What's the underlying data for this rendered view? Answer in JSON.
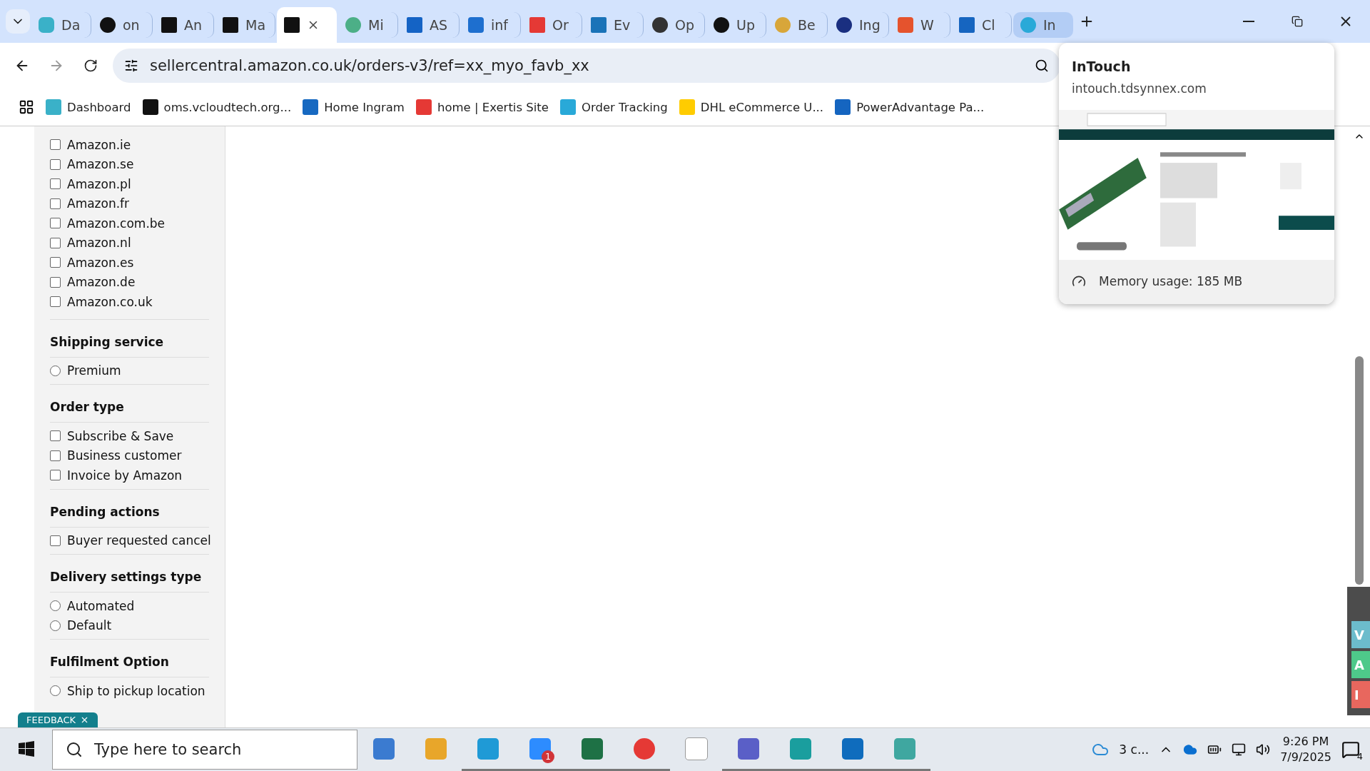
{
  "tabs": [
    {
      "label": "Da",
      "selected": false
    },
    {
      "label": "on",
      "selected": false
    },
    {
      "label": "An",
      "selected": false
    },
    {
      "label": "Ma",
      "selected": false
    },
    {
      "selected": true
    },
    {
      "label": "Mi",
      "selected": false
    },
    {
      "label": "AS",
      "selected": false
    },
    {
      "label": "inf",
      "selected": false
    },
    {
      "label": "Or",
      "selected": false
    },
    {
      "label": "Ev",
      "selected": false
    },
    {
      "label": "Op",
      "selected": false
    },
    {
      "label": "Up",
      "selected": false
    },
    {
      "label": "Be",
      "selected": false
    },
    {
      "label": "Ing",
      "selected": false
    },
    {
      "label": "W",
      "selected": false
    },
    {
      "label": "Cl",
      "selected": false
    },
    {
      "label": "In",
      "selected": false,
      "hovered": true
    }
  ],
  "address_bar": {
    "url": "sellercentral.amazon.co.uk/orders-v3/ref=xx_myo_favb_xx"
  },
  "bookmarks": [
    "Dashboard",
    "oms.vcloudtech.org...",
    "Home Ingram",
    "home | Exertis Site",
    "Order Tracking",
    "DHL eCommerce U...",
    "PowerAdvantage Pa..."
  ],
  "sidebar": {
    "sections": [
      {
        "items": [
          {
            "kind": "checkbox",
            "label": "Amazon.ie",
            "checked": false
          },
          {
            "kind": "checkbox",
            "label": "Amazon.se",
            "checked": false
          },
          {
            "kind": "checkbox",
            "label": "Amazon.pl",
            "checked": false
          },
          {
            "kind": "checkbox",
            "label": "Amazon.fr",
            "checked": false
          },
          {
            "kind": "checkbox",
            "label": "Amazon.com.be",
            "checked": false
          },
          {
            "kind": "checkbox",
            "label": "Amazon.nl",
            "checked": false
          },
          {
            "kind": "checkbox",
            "label": "Amazon.es",
            "checked": false
          },
          {
            "kind": "checkbox",
            "label": "Amazon.de",
            "checked": false
          },
          {
            "kind": "checkbox",
            "label": "Amazon.co.uk",
            "checked": false
          }
        ]
      },
      {
        "title": "Shipping service",
        "items": [
          {
            "kind": "radio",
            "label": "Premium",
            "selected": false
          }
        ]
      },
      {
        "title": "Order type",
        "items": [
          {
            "kind": "checkbox",
            "label": "Subscribe & Save",
            "checked": false
          },
          {
            "kind": "checkbox",
            "label": "Business customer",
            "checked": false
          },
          {
            "kind": "checkbox",
            "label": "Invoice by Amazon",
            "checked": false
          }
        ]
      },
      {
        "title": "Pending actions",
        "items": [
          {
            "kind": "checkbox",
            "label": "Buyer requested cancel",
            "checked": false
          }
        ]
      },
      {
        "title": "Delivery settings type",
        "items": [
          {
            "kind": "radio",
            "label": "Automated",
            "selected": false
          },
          {
            "kind": "radio",
            "label": "Default",
            "selected": false
          }
        ]
      },
      {
        "title": "Fulfilment Option",
        "items": [
          {
            "kind": "radio",
            "label": "Ship to pickup location",
            "selected": false
          }
        ]
      }
    ]
  },
  "feedback": {
    "label": "FEEDBACK"
  },
  "tab_preview": {
    "title": "InTouch",
    "url": "intouch.tdsynnex.com",
    "memory": "Memory usage: 185 MB"
  },
  "side_widget": [
    {
      "label": "V",
      "color": "#6cbccc"
    },
    {
      "label": "A",
      "color": "#4ec98a"
    },
    {
      "label": "I",
      "color": "#e8675e"
    }
  ],
  "taskbar": {
    "search_placeholder": "Type here to search",
    "weather": "3 c...",
    "time": "9:26 PM",
    "date": "7/9/2025",
    "notifications": "4",
    "zoom_badge": "1"
  }
}
